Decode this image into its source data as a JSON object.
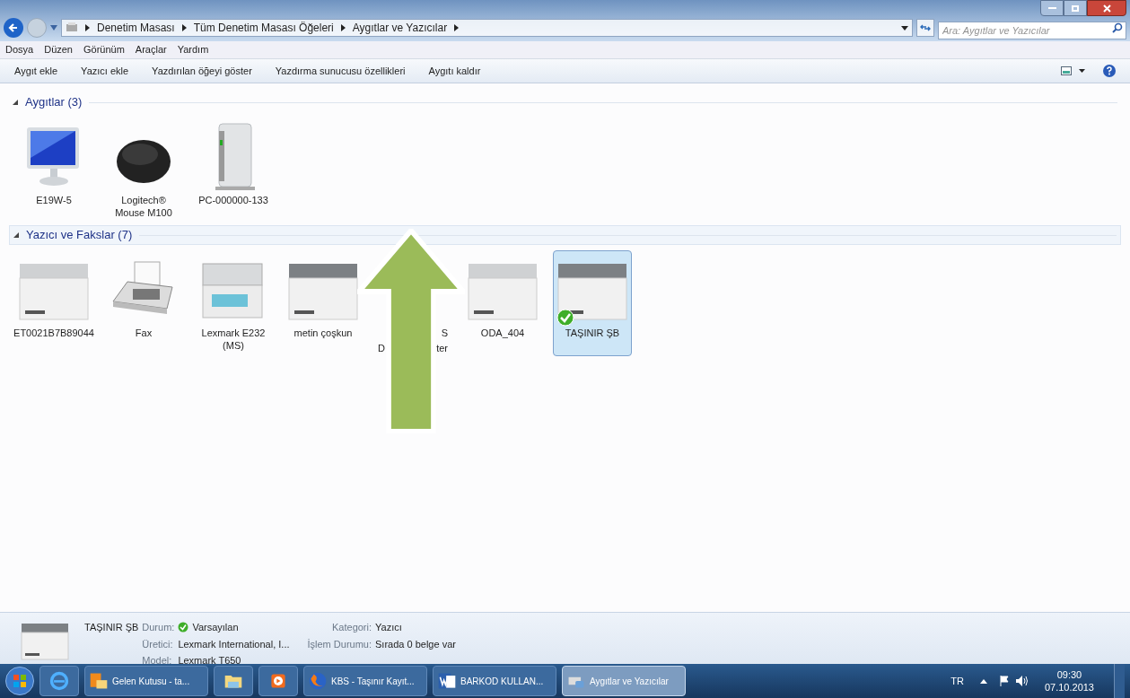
{
  "window": {
    "breadcrumb": [
      "Denetim Masası",
      "Tüm Denetim Masası Öğeleri",
      "Aygıtlar ve Yazıcılar"
    ],
    "search": {
      "placeholder": "Ara: Aygıtlar ve Yazıcılar"
    }
  },
  "menu": [
    "Dosya",
    "Düzen",
    "Görünüm",
    "Araçlar",
    "Yardım"
  ],
  "toolbar": [
    "Aygıt ekle",
    "Yazıcı ekle",
    "Yazdırılan öğeyi göster",
    "Yazdırma sunucusu özellikleri",
    "Aygıtı kaldır"
  ],
  "groups": [
    {
      "title": "Aygıtlar (3)",
      "expanded": true,
      "items": [
        {
          "kind": "monitor",
          "lines": [
            "E19W-5"
          ],
          "selected": false,
          "default": false
        },
        {
          "kind": "mouse",
          "lines": [
            "Logitech®",
            "Mouse M100"
          ],
          "selected": false,
          "default": false
        },
        {
          "kind": "computer",
          "lines": [
            "PC-000000-133"
          ],
          "selected": false,
          "default": false
        }
      ]
    },
    {
      "title": "Yazıcı ve Fakslar (7)",
      "expanded": true,
      "items": [
        {
          "kind": "printer",
          "lines": [
            "ET0021B7B89044"
          ],
          "selected": false,
          "default": false
        },
        {
          "kind": "fax",
          "lines": [
            "Fax"
          ],
          "selected": false,
          "default": false
        },
        {
          "kind": "mfp",
          "lines": [
            "Lexmark E232",
            "(MS)"
          ],
          "selected": false,
          "default": false
        },
        {
          "kind": "printer-dark",
          "lines": [
            "metin çoşkun"
          ],
          "selected": false,
          "default": false
        },
        {
          "kind": "covered",
          "fragments": [
            "S",
            "D",
            "ter"
          ],
          "selected": false,
          "default": false
        },
        {
          "kind": "printer",
          "lines": [
            "ODA_404"
          ],
          "selected": false,
          "default": false
        },
        {
          "kind": "printer-dark",
          "lines": [
            "TAŞINIR ŞB"
          ],
          "selected": true,
          "default": true
        }
      ]
    }
  ],
  "details": {
    "name": "TAŞINIR ŞB",
    "fields": [
      {
        "label": "Durum:",
        "value": "Varsayılan",
        "check": true
      },
      {
        "label": "Kategori:",
        "value": "Yazıcı",
        "check": false
      },
      {
        "label": "Üretici:",
        "value": "Lexmark International, I...",
        "check": false
      },
      {
        "label": "İşlem Durumu:",
        "value": "Sırada 0 belge var",
        "check": false
      },
      {
        "label": "Model:",
        "value": "Lexmark T650",
        "check": false
      }
    ]
  },
  "taskbar": {
    "items": [
      {
        "kind": "ie",
        "selected": false
      },
      {
        "kind": "outlook",
        "label": "Gelen Kutusu - ta...",
        "selected": false
      },
      {
        "kind": "folder",
        "selected": false
      },
      {
        "kind": "media",
        "selected": false
      },
      {
        "kind": "firefox",
        "label": "KBS - Taşınır Kayıt...",
        "selected": false
      },
      {
        "kind": "word",
        "label": "BARKOD KULLAN...",
        "selected": false
      },
      {
        "kind": "devices",
        "label": "Aygıtlar ve Yazıcılar",
        "selected": true
      }
    ],
    "language": "TR",
    "time": "09:30",
    "date": "07.10.2013"
  }
}
